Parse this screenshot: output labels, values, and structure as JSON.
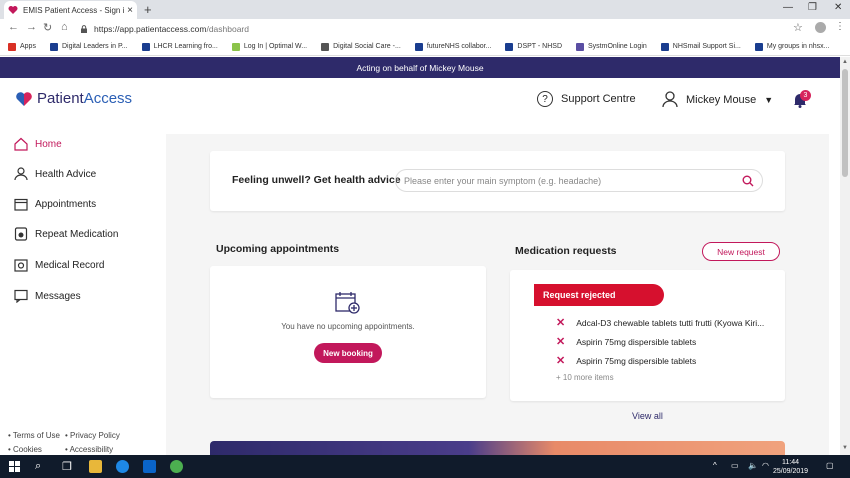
{
  "browser": {
    "tab_title": "EMIS Patient Access - Sign in or",
    "tab_close": "×",
    "new_tab": "+",
    "url_host": "https://app.patientaccess.com",
    "url_path": "/dashboard",
    "bookmarks": [
      {
        "label": "Apps",
        "color": "#d93025"
      },
      {
        "label": "Digital Leaders in P...",
        "color": "#1a3d8f"
      },
      {
        "label": "LHCR Learning fro...",
        "color": "#1a3d8f"
      },
      {
        "label": "Log In | Optimal W...",
        "color": "#8bc34a"
      },
      {
        "label": "Digital Social Care -...",
        "color": "#555555"
      },
      {
        "label": "futureNHS collabor...",
        "color": "#1a3d8f"
      },
      {
        "label": "DSPT - NHSD",
        "color": "#1a3d8f"
      },
      {
        "label": "SystmOnline Login",
        "color": "#5a4ea3"
      },
      {
        "label": "NHSmail Support Si...",
        "color": "#1a3d8f"
      },
      {
        "label": "My groups in nhsx...",
        "color": "#1a3d8f"
      }
    ]
  },
  "banner": {
    "text": "Acting on behalf of Mickey Mouse"
  },
  "header": {
    "logo_part1": "Patient",
    "logo_part2": "Access",
    "support_label": "Support Centre",
    "user_name": "Mickey Mouse",
    "notification_count": "3"
  },
  "sidebar": {
    "items": [
      {
        "label": "Home"
      },
      {
        "label": "Health Advice"
      },
      {
        "label": "Appointments"
      },
      {
        "label": "Repeat Medication"
      },
      {
        "label": "Medical Record"
      },
      {
        "label": "Messages"
      }
    ],
    "footer": [
      "• Terms of Use",
      "• Privacy Policy",
      "• Cookies",
      "• Accessibility"
    ]
  },
  "health_advice": {
    "question": "Feeling unwell? Get health advice",
    "placeholder": "Please enter your main symptom (e.g. headache)"
  },
  "appointments": {
    "title": "Upcoming appointments",
    "empty_text": "You have no upcoming appointments.",
    "new_booking_label": "New booking"
  },
  "medication": {
    "title": "Medication requests",
    "new_request_label": "New request",
    "status_label": "Request rejected",
    "items": [
      "Adcal-D3 chewable tablets tutti frutti (Kyowa Kiri...",
      "Aspirin 75mg dispersible tablets",
      "Aspirin 75mg dispersible tablets"
    ],
    "more_label": "+ 10 more items",
    "view_all_label": "View all"
  },
  "taskbar": {
    "time": "11:44",
    "date": "25/09/2019"
  },
  "colors": {
    "brand_navy": "#2e2a6a",
    "accent_pink": "#c2185b",
    "rejected_red": "#d6102e"
  }
}
